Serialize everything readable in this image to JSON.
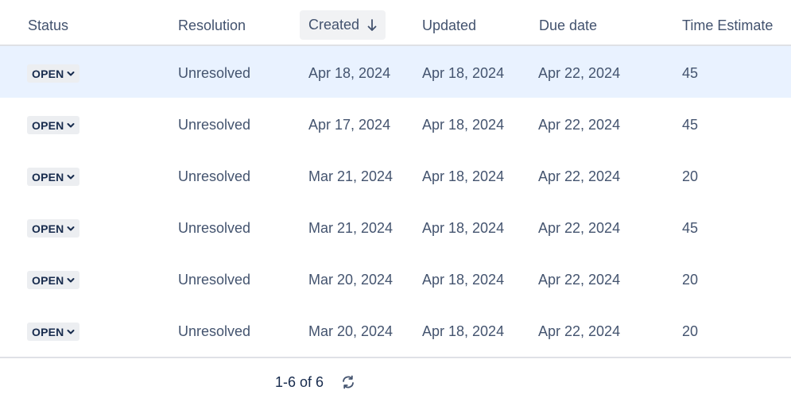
{
  "columns": {
    "status": "Status",
    "resolution": "Resolution",
    "created": "Created",
    "updated": "Updated",
    "due_date": "Due date",
    "time_estimate": "Time Estimate"
  },
  "sort": {
    "column": "Created",
    "direction": "descending",
    "icon": "arrow-down-icon"
  },
  "rows": [
    {
      "status": "OPEN",
      "resolution": "Unresolved",
      "created": "Apr 18, 2024",
      "updated": "Apr 18, 2024",
      "due_date": "Apr 22, 2024",
      "time_estimate": "45"
    },
    {
      "status": "OPEN",
      "resolution": "Unresolved",
      "created": "Apr 17, 2024",
      "updated": "Apr 18, 2024",
      "due_date": "Apr 22, 2024",
      "time_estimate": "45"
    },
    {
      "status": "OPEN",
      "resolution": "Unresolved",
      "created": "Mar 21, 2024",
      "updated": "Apr 18, 2024",
      "due_date": "Apr 22, 2024",
      "time_estimate": "20"
    },
    {
      "status": "OPEN",
      "resolution": "Unresolved",
      "created": "Mar 21, 2024",
      "updated": "Apr 18, 2024",
      "due_date": "Apr 22, 2024",
      "time_estimate": "45"
    },
    {
      "status": "OPEN",
      "resolution": "Unresolved",
      "created": "Mar 20, 2024",
      "updated": "Apr 18, 2024",
      "due_date": "Apr 22, 2024",
      "time_estimate": "20"
    },
    {
      "status": "OPEN",
      "resolution": "Unresolved",
      "created": "Mar 20, 2024",
      "updated": "Apr 18, 2024",
      "due_date": "Apr 22, 2024",
      "time_estimate": "20"
    }
  ],
  "pagination": {
    "label": "1-6 of 6",
    "refresh_icon": "refresh-icon"
  },
  "colors": {
    "selected_row": "#e9f2ff",
    "badge_bg": "#eceef1",
    "header_text": "#42526e",
    "cell_text": "#44546f"
  }
}
